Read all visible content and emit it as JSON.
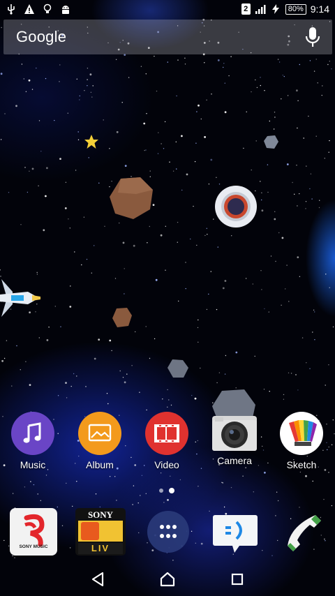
{
  "status_bar": {
    "sim_slot": "2",
    "battery_percent": "80%",
    "time": "9:14",
    "left_icons": [
      "usb-icon",
      "warning-icon",
      "bulb-icon",
      "android-icon"
    ],
    "right_icons": [
      "signal-icon",
      "charging-icon"
    ]
  },
  "search": {
    "label": "Google",
    "mic_icon": "mic-icon"
  },
  "home_apps": [
    {
      "label": "Music",
      "icon": "music-note-icon",
      "color": "#6a45c6"
    },
    {
      "label": "Album",
      "icon": "album-photo-icon",
      "color": "#f39a1c"
    },
    {
      "label": "Video",
      "icon": "film-strip-icon",
      "color": "#e0322f"
    },
    {
      "label": "Camera",
      "icon": "camera-icon",
      "color": "#d8d8d8"
    },
    {
      "label": "Sketch",
      "icon": "sketch-rainbow-icon",
      "color": "#ffffff"
    }
  ],
  "dock": {
    "sony_music": {
      "label": "SONY MUSIC",
      "icon": "sony-music-icon"
    },
    "sony_liv": {
      "brand": "SONY",
      "sub": "LIV",
      "icon": "sony-liv-icon"
    },
    "app_drawer": {
      "icon": "app-drawer-icon"
    },
    "messaging": {
      "icon": "messaging-icon"
    },
    "phone": {
      "icon": "phone-icon"
    }
  },
  "nav": {
    "back_icon": "back-icon",
    "home_icon": "home-icon",
    "recents_icon": "recents-icon"
  }
}
